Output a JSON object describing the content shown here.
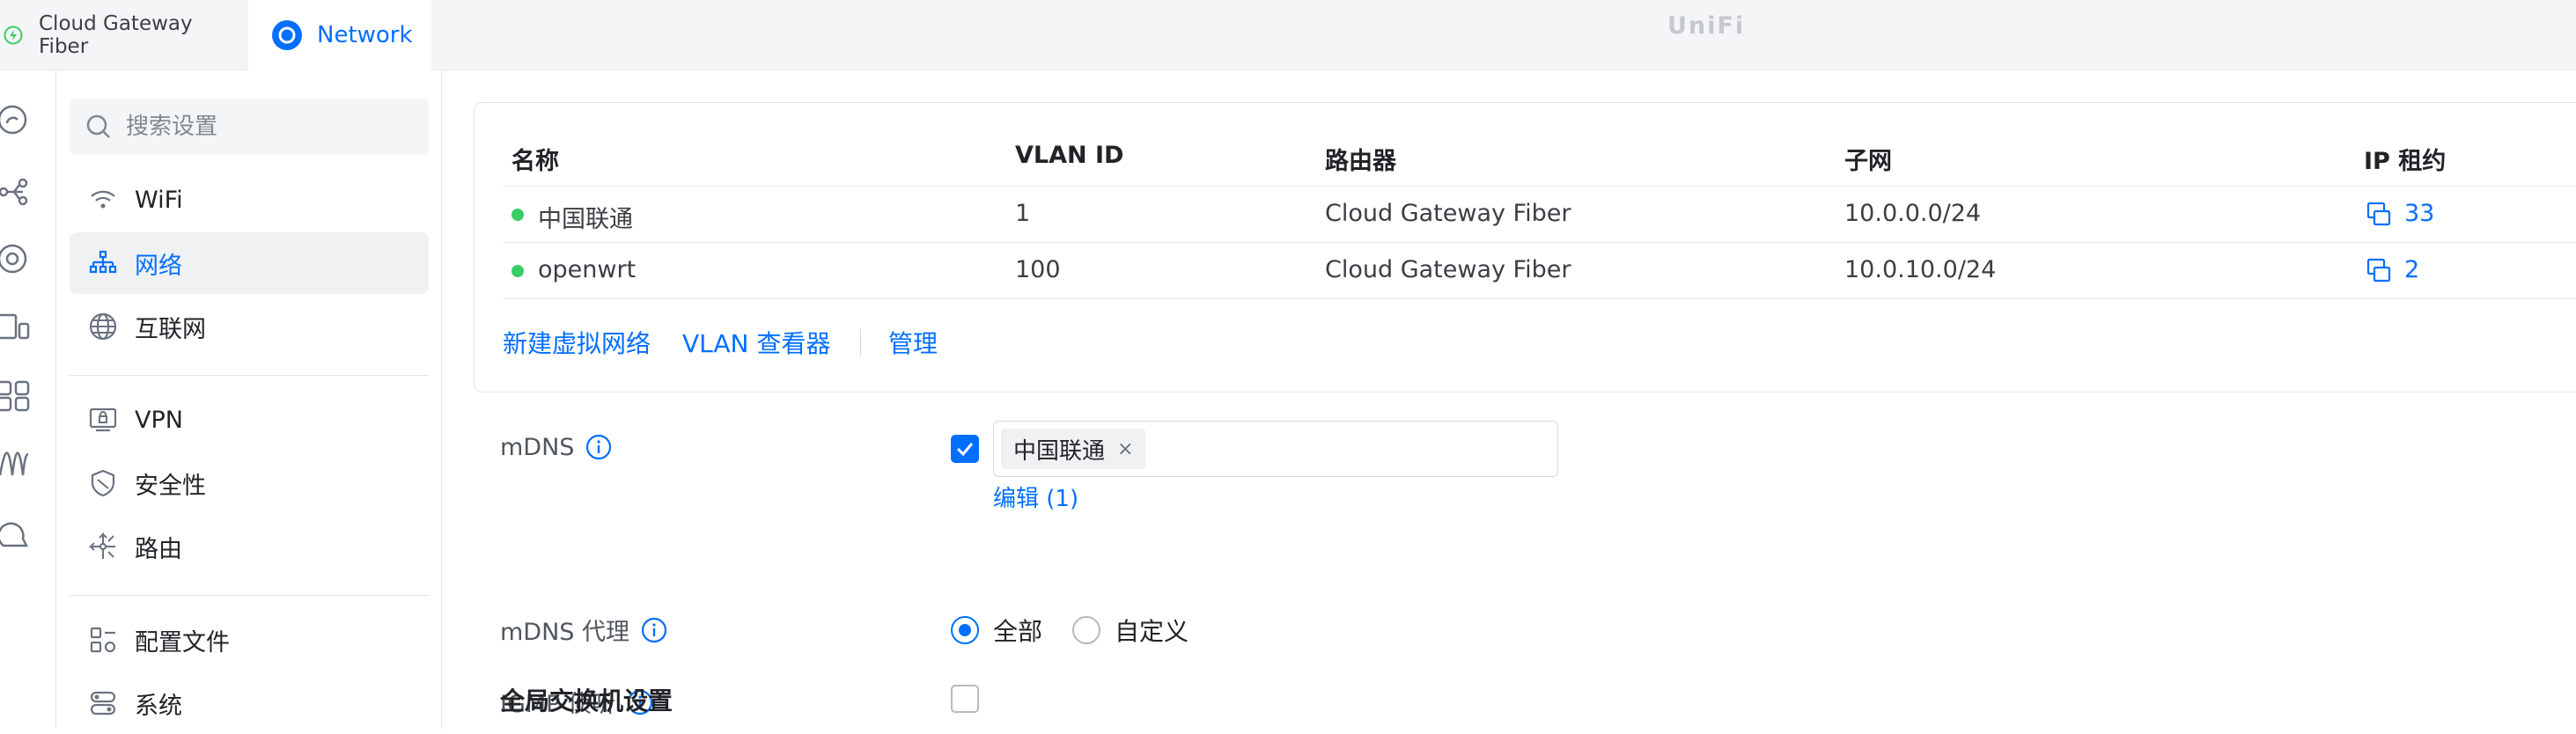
{
  "topbar": {
    "device_tab": "Cloud Gateway Fiber",
    "network_tab": "Network",
    "brand": "UniFi",
    "device_icon": "bolt-circle-icon",
    "network_icon": "network-app-icon"
  },
  "rail": {
    "icons": [
      "dashboard-icon",
      "topology-icon",
      "devices-icon",
      "clients-icon",
      "apps-icon",
      "insights-icon",
      "notifications-icon"
    ]
  },
  "sidebar": {
    "search_placeholder": "搜索设置",
    "items": [
      {
        "label": "WiFi",
        "icon": "wifi-icon",
        "active": false
      },
      {
        "label": "网络",
        "icon": "network-icon",
        "active": true
      },
      {
        "label": "互联网",
        "icon": "globe-icon",
        "active": false
      },
      {
        "label": "VPN",
        "icon": "vpn-icon",
        "active": false
      },
      {
        "label": "安全性",
        "icon": "shield-icon",
        "active": false
      },
      {
        "label": "路由",
        "icon": "routing-icon",
        "active": false
      },
      {
        "label": "配置文件",
        "icon": "profiles-icon",
        "active": false
      },
      {
        "label": "系统",
        "icon": "system-icon",
        "active": false
      }
    ]
  },
  "networks_table": {
    "columns": [
      "名称",
      "VLAN ID",
      "路由器",
      "子网",
      "IP 租约"
    ],
    "rows": [
      {
        "name": "中国联通",
        "vlan": "1",
        "router": "Cloud Gateway Fiber",
        "subnet": "10.0.0.0/24",
        "leases": "33",
        "status": "online"
      },
      {
        "name": "openwrt",
        "vlan": "100",
        "router": "Cloud Gateway Fiber",
        "subnet": "10.0.10.0/24",
        "leases": "2",
        "status": "online"
      }
    ],
    "actions": {
      "create": "新建虚拟网络",
      "vlan_viewer": "VLAN 查看器",
      "manage": "管理"
    }
  },
  "settings": {
    "mdns": {
      "label": "mDNS",
      "checked": true,
      "chip": "中国联通",
      "chip_remove": "×",
      "edit": "编辑 (1)"
    },
    "mdns_proxy": {
      "label": "mDNS 代理",
      "option_all": "全部",
      "option_custom": "自定义",
      "selected": "全部"
    },
    "igmp": {
      "label": "IGMP 侦听",
      "checked": false
    },
    "global_switch_title": "全局交换机设置"
  },
  "colors": {
    "accent": "#006fff",
    "online": "#38cc65",
    "text": "#212327",
    "muted": "#50565e"
  }
}
